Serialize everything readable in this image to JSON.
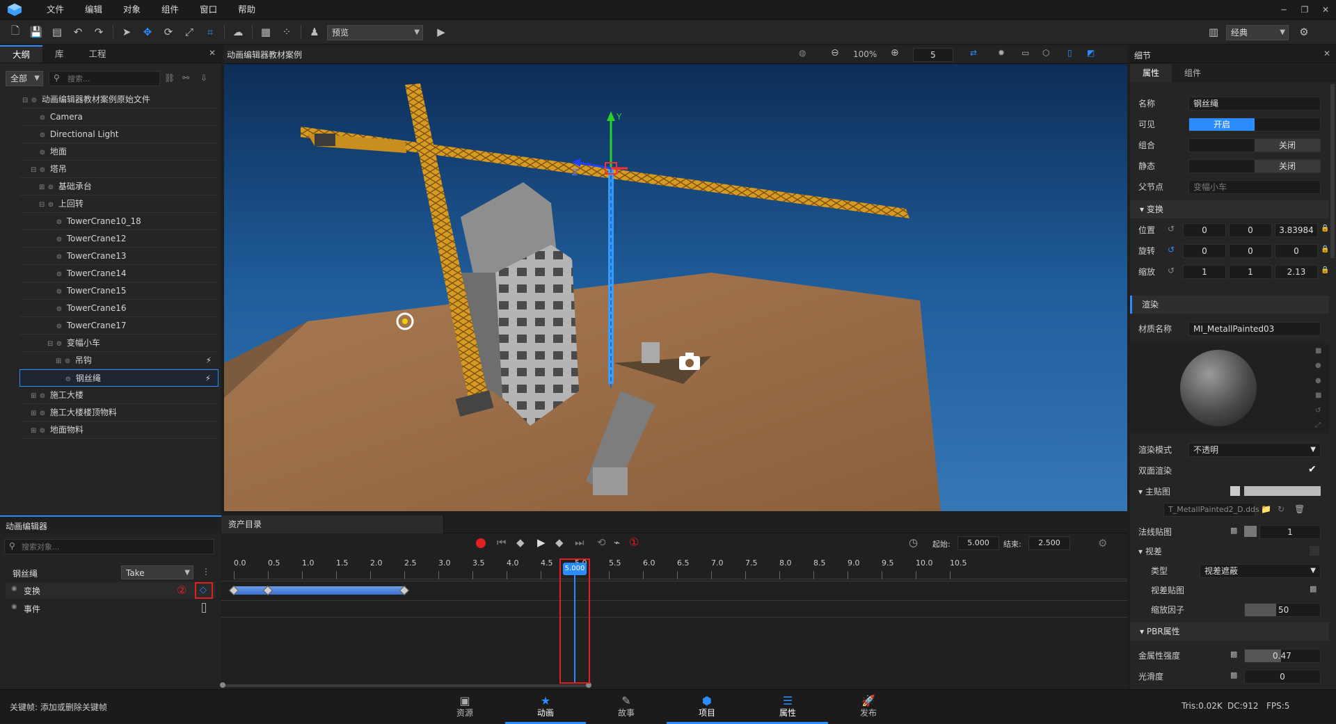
{
  "menu": [
    "文件",
    "编辑",
    "对象",
    "组件",
    "窗口",
    "帮助"
  ],
  "toolbar": {
    "preview_select": "预览",
    "layout_select": "经典"
  },
  "left_panel": {
    "tabs": [
      "大纲",
      "库",
      "工程"
    ],
    "filter": "全部",
    "search_placeholder": "搜索...",
    "tree": [
      {
        "label": "动画编辑器教材案例原始文件",
        "depth": 0,
        "exp": "⊟"
      },
      {
        "label": "Camera",
        "depth": 1,
        "exp": ""
      },
      {
        "label": "Directional Light",
        "depth": 1,
        "exp": ""
      },
      {
        "label": "地面",
        "depth": 1,
        "exp": ""
      },
      {
        "label": "塔吊",
        "depth": 1,
        "exp": "⊟"
      },
      {
        "label": "基础承台",
        "depth": 2,
        "exp": "⊞"
      },
      {
        "label": "上回转",
        "depth": 2,
        "exp": "⊟"
      },
      {
        "label": "TowerCrane10_18",
        "depth": 3,
        "exp": ""
      },
      {
        "label": "TowerCrane12",
        "depth": 3,
        "exp": ""
      },
      {
        "label": "TowerCrane13",
        "depth": 3,
        "exp": ""
      },
      {
        "label": "TowerCrane14",
        "depth": 3,
        "exp": ""
      },
      {
        "label": "TowerCrane15",
        "depth": 3,
        "exp": ""
      },
      {
        "label": "TowerCrane16",
        "depth": 3,
        "exp": ""
      },
      {
        "label": "TowerCrane17",
        "depth": 3,
        "exp": ""
      },
      {
        "label": "变幅小车",
        "depth": 3,
        "exp": "⊟"
      },
      {
        "label": "吊钩",
        "depth": 4,
        "exp": "⊞"
      },
      {
        "label": "钢丝绳",
        "depth": 4,
        "exp": ""
      },
      {
        "label": "施工大楼",
        "depth": 1,
        "exp": "⊞"
      },
      {
        "label": "施工大楼楼顶物料",
        "depth": 1,
        "exp": "⊞"
      },
      {
        "label": "地面物料",
        "depth": 1,
        "exp": "⊞"
      }
    ]
  },
  "viewport": {
    "title": "动画编辑器教材案例",
    "zoom": "100%",
    "speed": "5",
    "axis_y": "Y",
    "axis_z": "Z"
  },
  "right_panel": {
    "title": "细节",
    "tabs": [
      "属性",
      "组件"
    ],
    "name_label": "名称",
    "name_value": "钢丝绳",
    "visible_label": "可见",
    "visible_value": "开启",
    "group_label": "组合",
    "group_value": "关闭",
    "static_label": "静态",
    "static_value": "关闭",
    "parent_label": "父节点",
    "parent_value": "变幅小车",
    "transform_section": "变换",
    "position_label": "位置",
    "position": [
      "0",
      "0",
      "3.83984"
    ],
    "rotation_label": "旋转",
    "rotation": [
      "0",
      "0",
      "0"
    ],
    "scale_label": "缩放",
    "scale": [
      "1",
      "1",
      "2.13"
    ],
    "render_section": "渲染",
    "material_label": "材质名称",
    "material_value": "MI_MetallPainted03",
    "render_mode_label": "渲染模式",
    "render_mode_value": "不透明",
    "double_side_label": "双面渲染",
    "main_tex_label": "主贴图",
    "main_tex_file": "T_MetallPainted2_D.dds",
    "normal_tex_label": "法线贴图",
    "normal_tex_value": "1",
    "parallax_label": "视差",
    "type_label": "类型",
    "type_value": "视差遮蔽",
    "parallax_tex_label": "视差贴图",
    "scale_factor_label": "缩放因子",
    "scale_factor_value": "50",
    "pbr_section": "PBR属性",
    "metal_label": "金属性强度",
    "metal_value": "0.47",
    "smooth_label": "光滑度",
    "smooth_value": "0"
  },
  "anim_panel": {
    "title": "动画编辑器",
    "search_placeholder": "搜索对象...",
    "object_name": "钢丝绳",
    "take_select": "Take",
    "tracks": [
      "变换",
      "事件"
    ],
    "callout_2": "②"
  },
  "timeline": {
    "tab": "资产目录",
    "start_label": "起始:",
    "start_value": "5.000",
    "end_label": "结束:",
    "end_value": "2.500",
    "playhead": "5.000",
    "callout_1": "①",
    "ticks": [
      "0.0",
      "0.5",
      "1.0",
      "1.5",
      "2.0",
      "2.5",
      "3.0",
      "3.5",
      "4.0",
      "4.5",
      "5.0",
      "5.5",
      "6.0",
      "6.5",
      "7.0",
      "7.5",
      "8.0",
      "8.5",
      "9.0",
      "9.5",
      "10.0",
      "10.5"
    ],
    "keyframes": [
      0.0,
      0.5,
      2.5
    ]
  },
  "status": {
    "hint": "关键帧: 添加或删除关键帧",
    "tabs": [
      "资源",
      "动画",
      "故事",
      "项目",
      "属性",
      "发布"
    ],
    "tris": "Tris:0.02K",
    "dc": "DC:912",
    "fps": "FPS:5"
  },
  "colors": {
    "accent": "#2b8cff",
    "callout": "#e02020"
  }
}
